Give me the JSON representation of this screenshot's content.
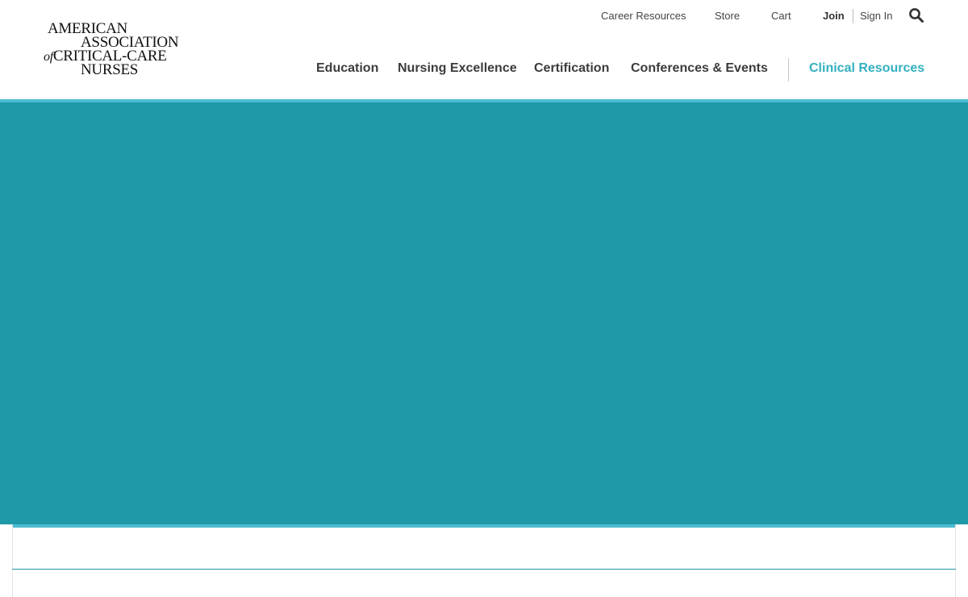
{
  "logo": {
    "line1": "AMERICAN",
    "line2": "ASSOCIATION",
    "line3_prefix": "of",
    "line3": "CRITICAL-CARE",
    "line4": "NURSES"
  },
  "utility_nav": {
    "career_resources": "Career Resources",
    "store": "Store",
    "cart": "Cart",
    "join": "Join",
    "sign_in": "Sign In",
    "search_icon": "search-icon"
  },
  "main_nav": {
    "items": [
      {
        "label": "Education"
      },
      {
        "label": "Nursing Excellence"
      },
      {
        "label": "Certification"
      },
      {
        "label": "Conferences & Events"
      },
      {
        "label": "Clinical Resources"
      }
    ]
  },
  "colors": {
    "accent_teal": "#1f99a8",
    "accent_light": "#4cbcd0",
    "active_nav": "#34b0c0"
  }
}
